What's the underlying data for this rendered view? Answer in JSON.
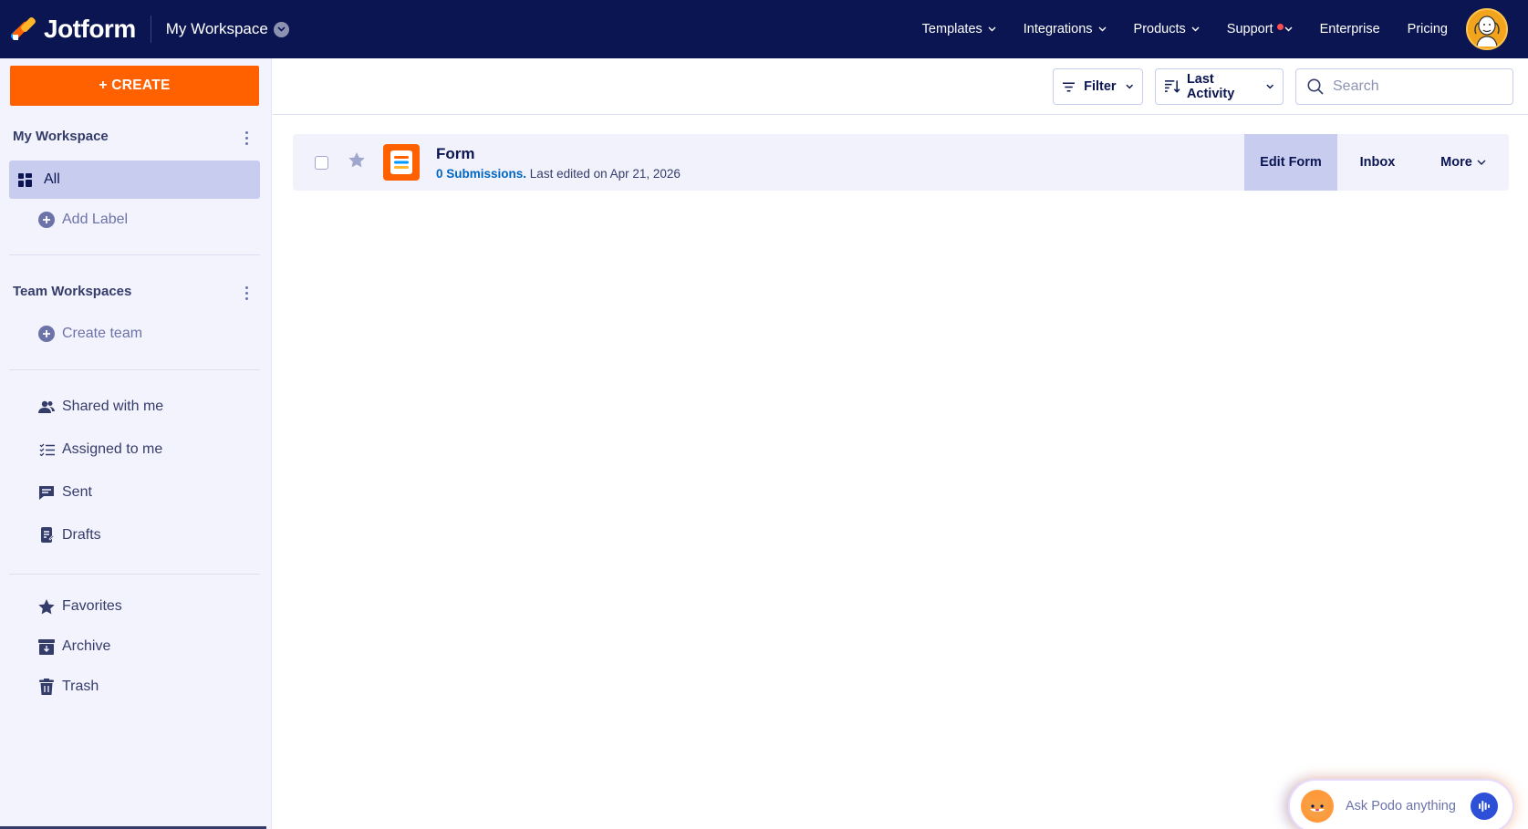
{
  "brand": {
    "name": "Jotform"
  },
  "header": {
    "workspace_label": "My Workspace",
    "nav": [
      {
        "label": "Templates"
      },
      {
        "label": "Integrations"
      },
      {
        "label": "Products"
      },
      {
        "label": "Support"
      },
      {
        "label": "Enterprise"
      },
      {
        "label": "Pricing"
      }
    ]
  },
  "sidebar": {
    "create_label": "+ CREATE",
    "my_workspace_heading": "My Workspace",
    "all_label": "All",
    "add_label": "Add Label",
    "team_heading": "Team Workspaces",
    "create_team": "Create team",
    "links": [
      {
        "label": "Shared with me",
        "icon": "users-icon"
      },
      {
        "label": "Assigned to me",
        "icon": "checklist-icon"
      },
      {
        "label": "Sent",
        "icon": "message-icon"
      },
      {
        "label": "Drafts",
        "icon": "draft-icon"
      },
      {
        "label": "Favorites",
        "icon": "star-icon"
      },
      {
        "label": "Archive",
        "icon": "archive-icon"
      },
      {
        "label": "Trash",
        "icon": "trash-icon"
      }
    ]
  },
  "toolbar": {
    "filter_label": "Filter",
    "sort_label": "Last Activity",
    "search_placeholder": "Search"
  },
  "forms": [
    {
      "title": "Form",
      "submissions": "0 Submissions.",
      "edited": "Last edited on Apr 21, 2026",
      "edit_label": "Edit Form",
      "inbox_label": "Inbox",
      "more_label": "More"
    }
  ],
  "assistant": {
    "prompt": "Ask Podo anything"
  },
  "colors": {
    "nav_bg": "#0a1551",
    "accent": "#ff6100",
    "sidebar_bg": "#f3f3fe",
    "selected": "#c8ccef",
    "link": "#0066c3"
  }
}
